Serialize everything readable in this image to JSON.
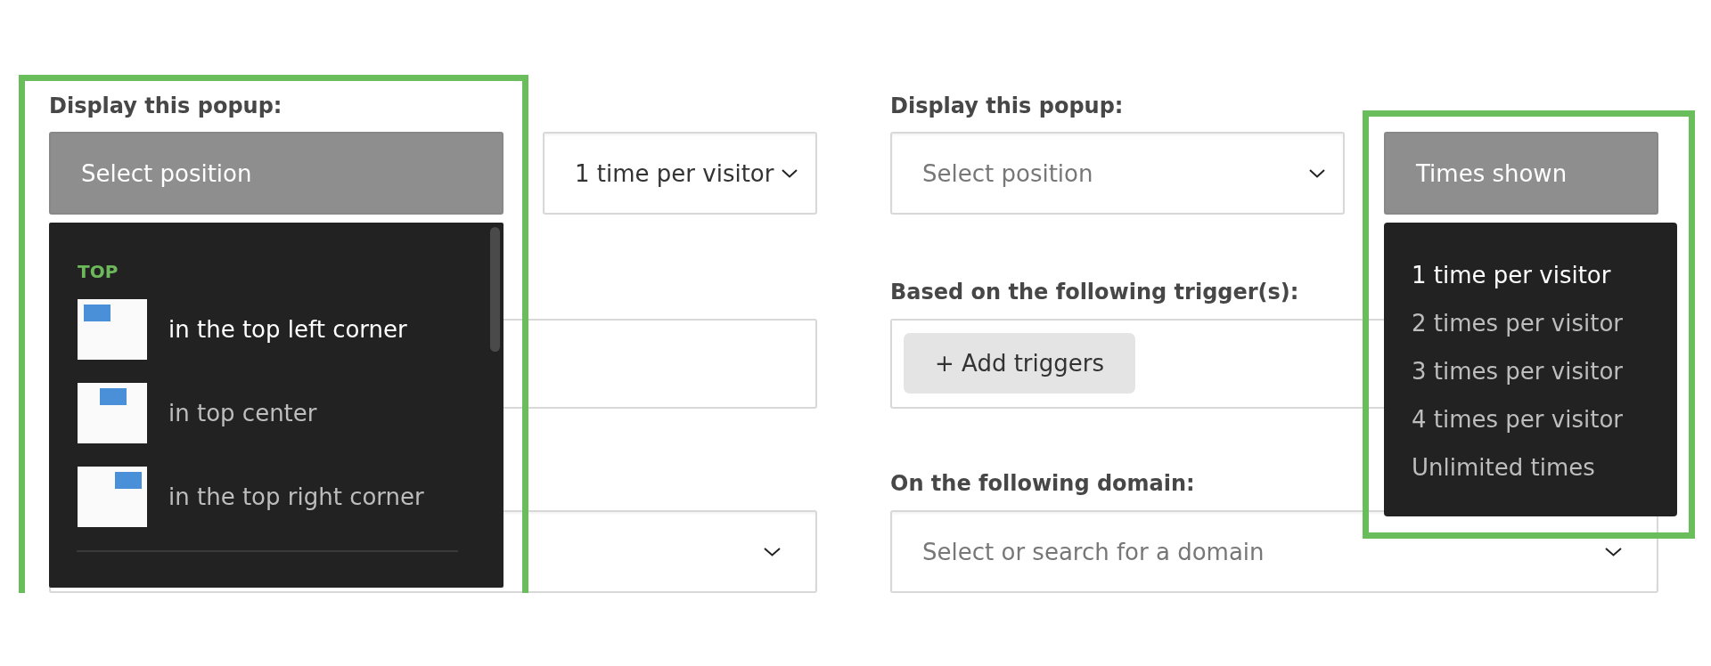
{
  "forms": [
    {
      "rows": [
        {
          "kind": "display",
          "label": "Display this popup:",
          "selects": [
            {
              "kind": "position",
              "placeholder": "Select position",
              "open": true,
              "highlighted": true,
              "menu": {
                "groups": [
                  {
                    "title": "TOP",
                    "options": [
                      {
                        "kind": "left",
                        "label": "in the top left corner",
                        "selected": true
                      },
                      {
                        "kind": "center",
                        "label": "in top center",
                        "selected": false
                      },
                      {
                        "kind": "right",
                        "label": "in the top right corner",
                        "selected": false
                      }
                    ]
                  }
                ]
              }
            },
            {
              "kind": "times",
              "value": "1 time per visitor",
              "open": false,
              "highlighted": false
            }
          ]
        },
        {
          "kind": "triggers"
        },
        {
          "kind": "domain"
        }
      ]
    },
    {
      "rows": [
        {
          "kind": "display",
          "label": "Display this popup:",
          "selects": [
            {
              "kind": "position",
              "placeholder": "Select position",
              "open": false,
              "highlighted": false
            },
            {
              "kind": "times",
              "placeholder": "Times shown",
              "open": true,
              "highlighted": true,
              "menu": {
                "options": [
                  {
                    "label": "1 time per visitor",
                    "selected": true
                  },
                  {
                    "label": "2 times per visitor",
                    "selected": false
                  },
                  {
                    "label": "3 times per visitor",
                    "selected": false
                  },
                  {
                    "label": "4 times per visitor",
                    "selected": false
                  },
                  {
                    "label": "Unlimited times",
                    "selected": false
                  }
                ]
              }
            }
          ]
        },
        {
          "kind": "triggers",
          "label": "Based on the following trigger(s):",
          "button": "+ Add triggers"
        },
        {
          "kind": "domain",
          "label": "On the following domain:",
          "placeholder": "Select or search for a domain"
        }
      ]
    }
  ]
}
